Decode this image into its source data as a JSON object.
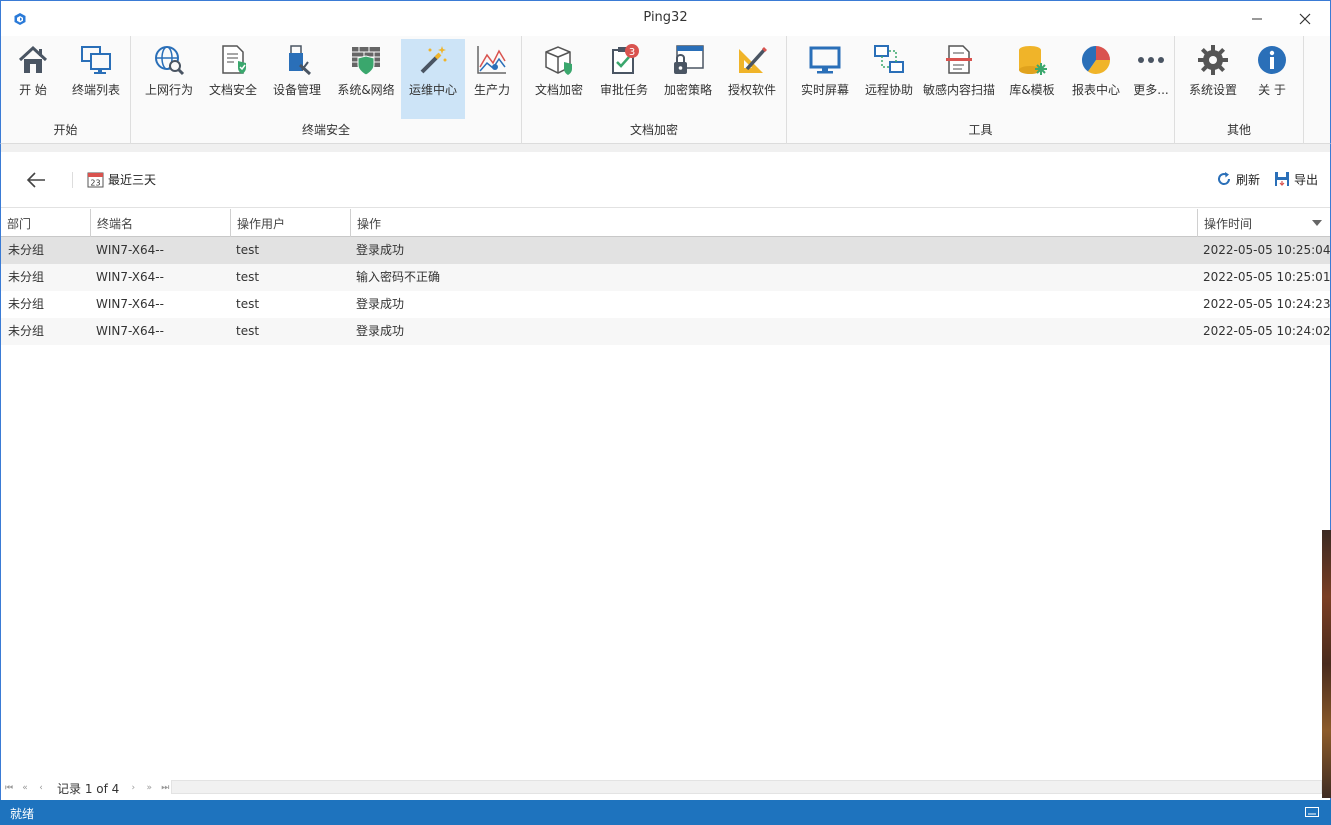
{
  "window": {
    "title": "Ping32",
    "minimize_icon": "minimize-icon",
    "close_icon": "close-icon"
  },
  "ribbon": {
    "groups": [
      {
        "label": "开始",
        "buttons": [
          {
            "label": "开 始",
            "icon": "home-icon"
          },
          {
            "label": "终端列表",
            "icon": "computers-icon"
          }
        ]
      },
      {
        "label": "终端安全",
        "buttons": [
          {
            "label": "上网行为",
            "icon": "globe-search-icon"
          },
          {
            "label": "文档安全",
            "icon": "document-shield-icon"
          },
          {
            "label": "设备管理",
            "icon": "usb-device-icon"
          },
          {
            "label": "系统&网络",
            "icon": "firewall-shield-icon"
          },
          {
            "label": "运维中心",
            "icon": "magic-wand-icon",
            "active": true
          },
          {
            "label": "生产力",
            "icon": "productivity-chart-icon"
          }
        ]
      },
      {
        "label": "文档加密",
        "buttons": [
          {
            "label": "文档加密",
            "icon": "box-shield-icon"
          },
          {
            "label": "审批任务",
            "icon": "clipboard-check-icon",
            "badge": "3"
          },
          {
            "label": "加密策略",
            "icon": "lock-window-icon"
          },
          {
            "label": "授权软件",
            "icon": "ruler-pencil-icon"
          }
        ]
      },
      {
        "label": "工具",
        "buttons": [
          {
            "label": "实时屏幕",
            "icon": "monitor-icon"
          },
          {
            "label": "远程协助",
            "icon": "remote-network-icon"
          },
          {
            "label": "敏感内容扫描",
            "icon": "document-scan-icon"
          },
          {
            "label": "库&模板",
            "icon": "database-icon"
          },
          {
            "label": "报表中心",
            "icon": "pie-chart-icon"
          },
          {
            "label": "更多...",
            "icon": "more-dots-icon"
          }
        ]
      },
      {
        "label": "其他",
        "buttons": [
          {
            "label": "系统设置",
            "icon": "gear-icon"
          },
          {
            "label": "关 于",
            "icon": "info-icon"
          }
        ]
      }
    ]
  },
  "toolbar": {
    "range_label": "最近三天",
    "calendar_day": "23",
    "refresh_label": "刷新",
    "export_label": "导出"
  },
  "table": {
    "columns": [
      "部门",
      "终端名",
      "操作用户",
      "操作",
      "操作时间"
    ],
    "rows": [
      [
        "未分组",
        "WIN7-X64--",
        "test",
        "登录成功",
        "2022-05-05 10:25:04"
      ],
      [
        "未分组",
        "WIN7-X64--",
        "test",
        "输入密码不正确",
        "2022-05-05 10:25:01"
      ],
      [
        "未分组",
        "WIN7-X64--",
        "test",
        "登录成功",
        "2022-05-05 10:24:23"
      ],
      [
        "未分组",
        "WIN7-X64--",
        "test",
        "登录成功",
        "2022-05-05 10:24:02"
      ]
    ]
  },
  "pager": {
    "record_text": "记录 1 of 4"
  },
  "status": {
    "text": "就绪"
  }
}
